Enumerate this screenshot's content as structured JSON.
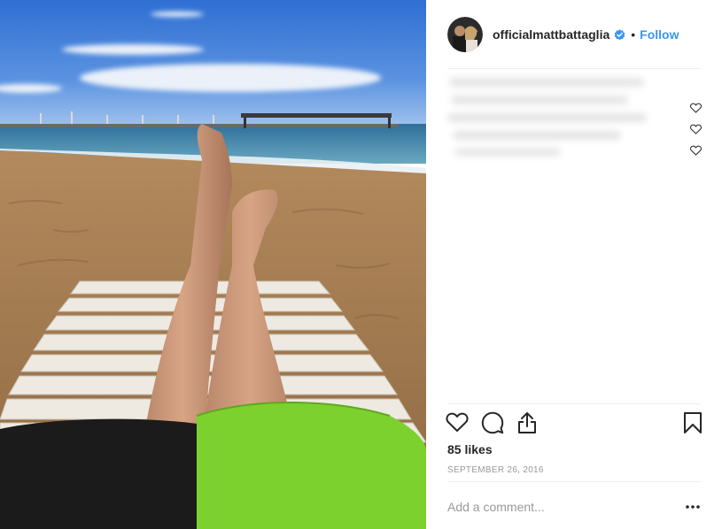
{
  "post": {
    "username": "officialmattbattaglia",
    "verified": true,
    "separator": "•",
    "follow_label": "Follow",
    "likes_text": "85 likes",
    "date_text": "SEPTEMBER 26, 2016",
    "comment_placeholder": "Add a comment..."
  },
  "icons": {
    "verified": "verified-badge-icon",
    "like": "heart-icon",
    "comment": "comment-bubble-icon",
    "share": "share-icon",
    "save": "bookmark-icon",
    "more": "ellipsis-icon"
  },
  "colors": {
    "link_blue": "#3897f0",
    "text": "#262626",
    "muted": "#999999",
    "divider": "#efefef"
  }
}
